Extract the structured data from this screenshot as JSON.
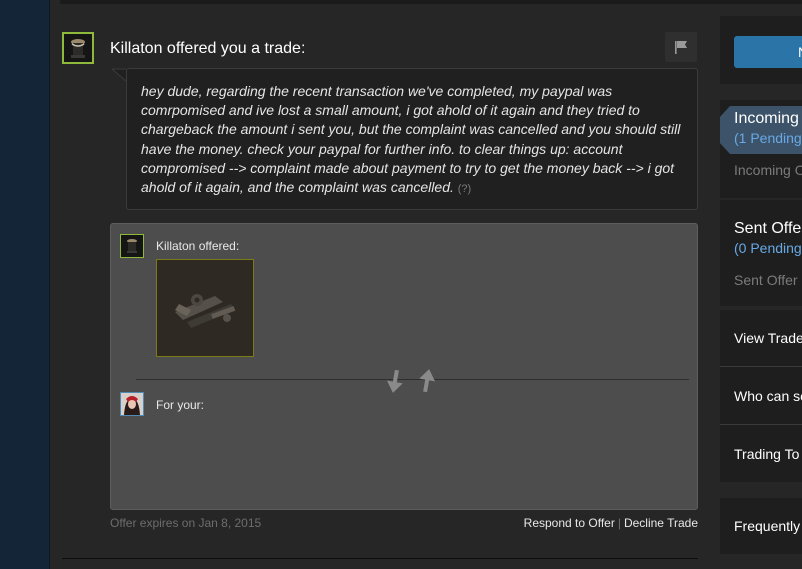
{
  "offer": {
    "title": "Killaton offered you a trade:",
    "message": "hey dude, regarding the recent transaction we've completed, my paypal was comrpomised and ive lost a small amount, i got ahold of it again and they tried to chargeback the amount i sent you, but the complaint was cancelled and you should still have the money. check your paypal for further info. to clear things up: account compromised --> complaint made about payment to try to get the money back --> i got ahold of it again, and the complaint was cancelled.",
    "message_help": "(?)",
    "offered_label": "Killaton offered:",
    "for_your_label": "For your:",
    "expires": "Offer expires on Jan 8, 2015",
    "respond_label": "Respond to Offer",
    "separator": "|",
    "decline_label": "Decline Trade"
  },
  "sidebar": {
    "new_button_label": "N",
    "incoming": {
      "title": "Incoming",
      "pending": "(1 Pending",
      "sub": "Incoming O"
    },
    "sent": {
      "title": "Sent Offe",
      "pending": "(0 Pending",
      "sub": "Sent Offer"
    },
    "links": [
      "View Trade",
      "Who can se",
      "Trading To"
    ],
    "faq": "Frequently"
  },
  "colors": {
    "accent_blue": "#67a9e6",
    "avatar_border_green": "#8fb93b",
    "button_blue": "#2a74a7"
  },
  "icons": [
    "flag-icon",
    "trade-arrows-icon"
  ]
}
